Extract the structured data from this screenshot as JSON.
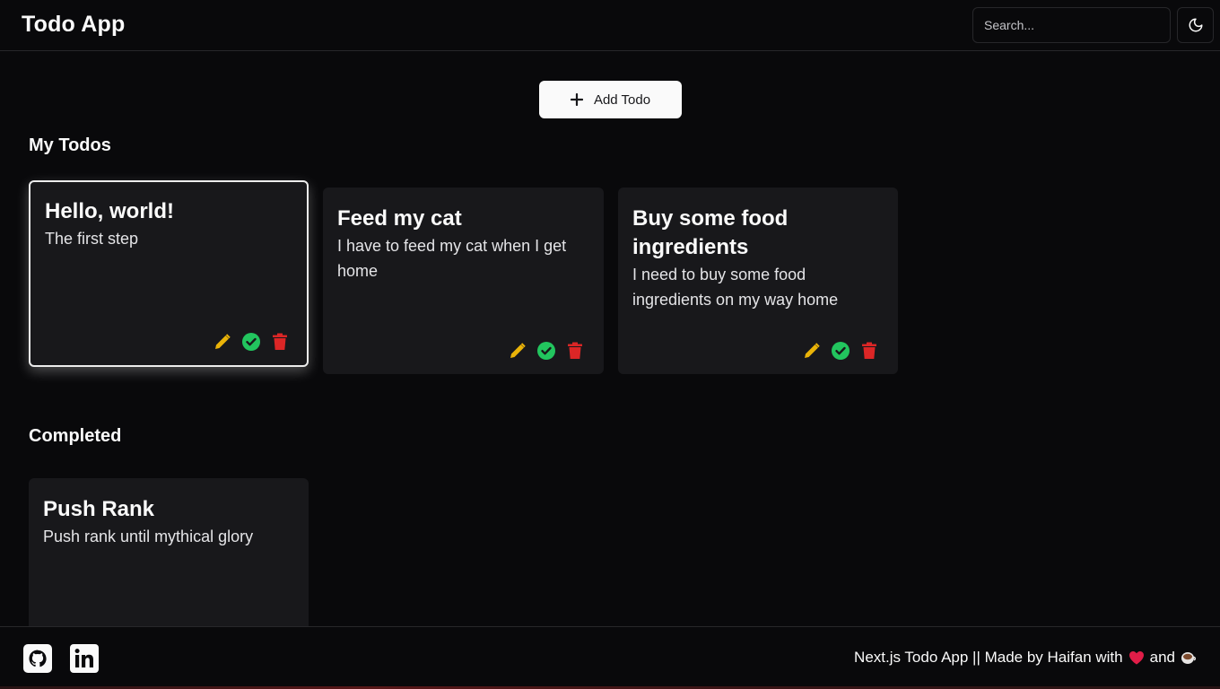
{
  "header": {
    "title": "Todo App",
    "search_placeholder": "Search...",
    "theme_icon": "moon-icon"
  },
  "add_button": {
    "label": "Add Todo",
    "icon": "plus-icon"
  },
  "sections": {
    "my_todos": {
      "title": "My Todos",
      "items": [
        {
          "title": "Hello, world!",
          "description": "The first step",
          "selected": true
        },
        {
          "title": "Feed my cat",
          "description": "I have to feed my cat when I get home",
          "selected": false
        },
        {
          "title": "Buy some food ingredients",
          "description": "I need to buy some food ingredients on my way home",
          "selected": false
        }
      ]
    },
    "completed": {
      "title": "Completed",
      "items": [
        {
          "title": "Push Rank",
          "description": "Push rank until mythical glory"
        }
      ]
    }
  },
  "actions": {
    "edit_icon": "pencil-icon",
    "complete_icon": "check-circle-icon",
    "delete_icon": "trash-icon"
  },
  "colors": {
    "background": "#09090b",
    "card": "#18181b",
    "edit": "#eab308",
    "complete": "#22c55e",
    "delete": "#dc2626"
  },
  "footer": {
    "text_prefix": "Next.js Todo App || Made by Haifan with",
    "text_and": "and",
    "heart_icon": "heart-icon",
    "coffee_icon": "coffee-icon",
    "social": [
      "github-icon",
      "linkedin-icon"
    ]
  }
}
